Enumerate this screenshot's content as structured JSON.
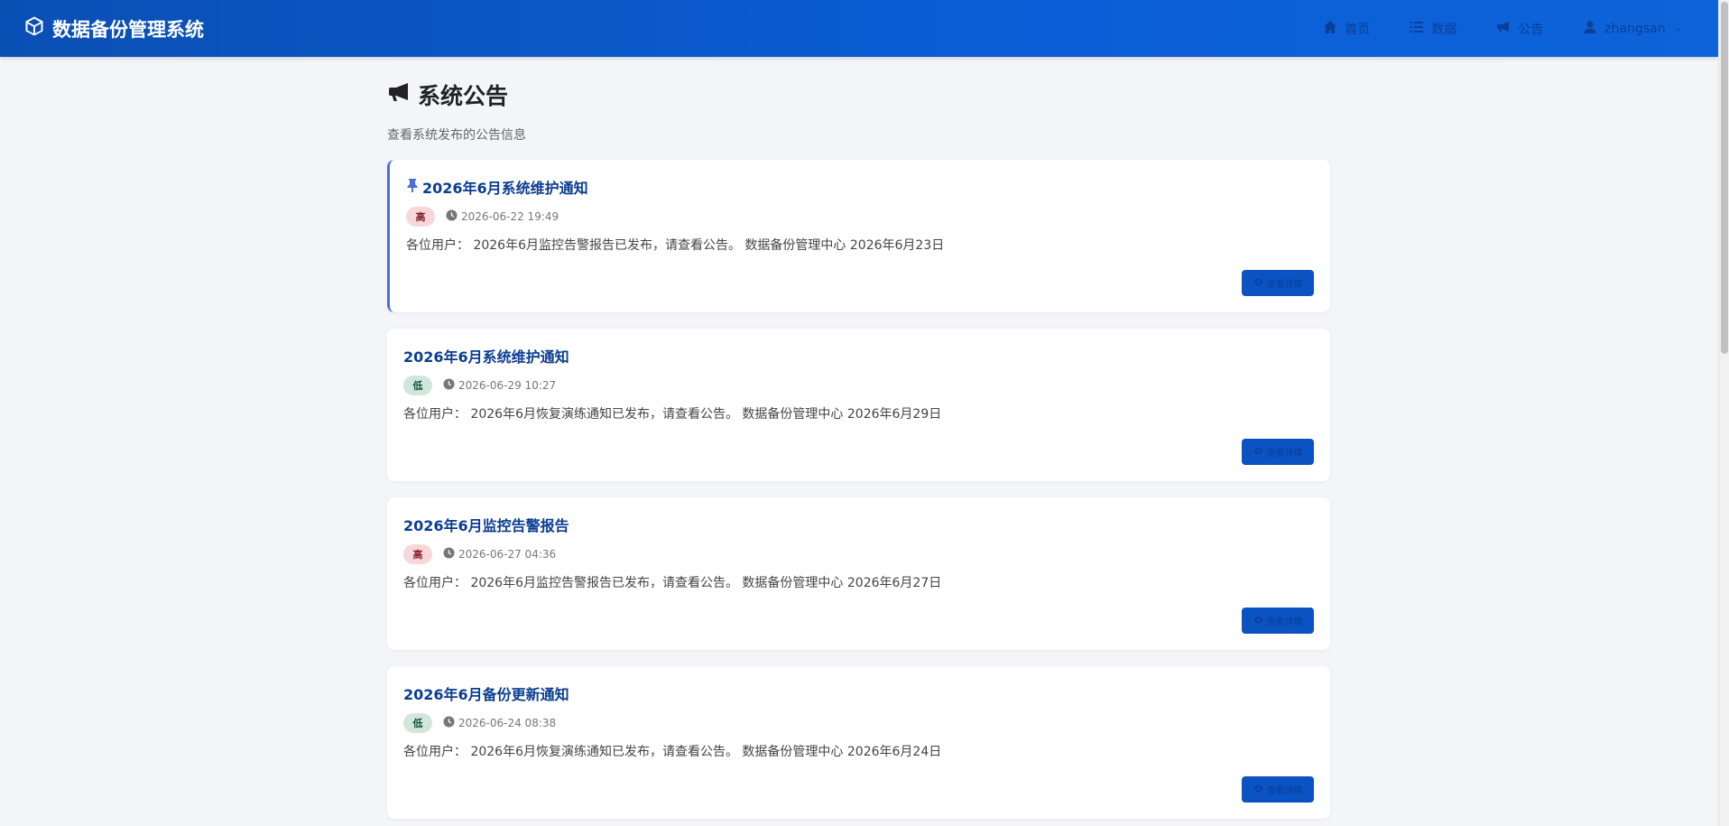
{
  "app": {
    "brand_title": "数据备份管理系统"
  },
  "nav": {
    "home": "首页",
    "data": "数据",
    "announcements": "公告",
    "user": "zhangsan"
  },
  "page": {
    "title": "系统公告",
    "subtitle": "查看系统发布的公告信息"
  },
  "announcements": [
    {
      "title": "2026年6月系统维护通知",
      "pinned": true,
      "priority": "高",
      "priority_level": "high",
      "datetime": "2026-06-22 19:49",
      "content": "各位用户： 2026年6月监控告警报告已发布，请查看公告。 数据备份管理中心 2026年6月23日",
      "button_label": "查看详情"
    },
    {
      "title": "2026年6月系统维护通知",
      "pinned": false,
      "priority": "低",
      "priority_level": "low",
      "datetime": "2026-06-29 10:27",
      "content": "各位用户： 2026年6月恢复演练通知已发布，请查看公告。 数据备份管理中心 2026年6月29日",
      "button_label": "查看详情"
    },
    {
      "title": "2026年6月监控告警报告",
      "pinned": false,
      "priority": "高",
      "priority_level": "high",
      "datetime": "2026-06-27 04:36",
      "content": "各位用户： 2026年6月监控告警报告已发布，请查看公告。 数据备份管理中心 2026年6月27日",
      "button_label": "查看详情"
    },
    {
      "title": "2026年6月备份更新通知",
      "pinned": false,
      "priority": "低",
      "priority_level": "low",
      "datetime": "2026-06-24 08:38",
      "content": "各位用户： 2026年6月恢复演练通知已发布，请查看公告。 数据备份管理中心 2026年6月24日",
      "button_label": "查看详情"
    }
  ],
  "colors": {
    "navbar": "#0b5ed7",
    "title_blue": "#0b3d91",
    "button": "#0b52c2",
    "badge_high_bg": "#f8d7da",
    "badge_low_bg": "#d1e7dd",
    "pin_accent": "#4a6fd8",
    "page_bg": "#f3f5f9"
  },
  "icons": {
    "brand": "cube-icon",
    "home": "home-icon",
    "data": "list-icon",
    "announcements": "megaphone-icon",
    "user": "user-icon",
    "pin": "thumbtack-icon",
    "clock": "clock-icon",
    "detail": "eye-icon"
  }
}
